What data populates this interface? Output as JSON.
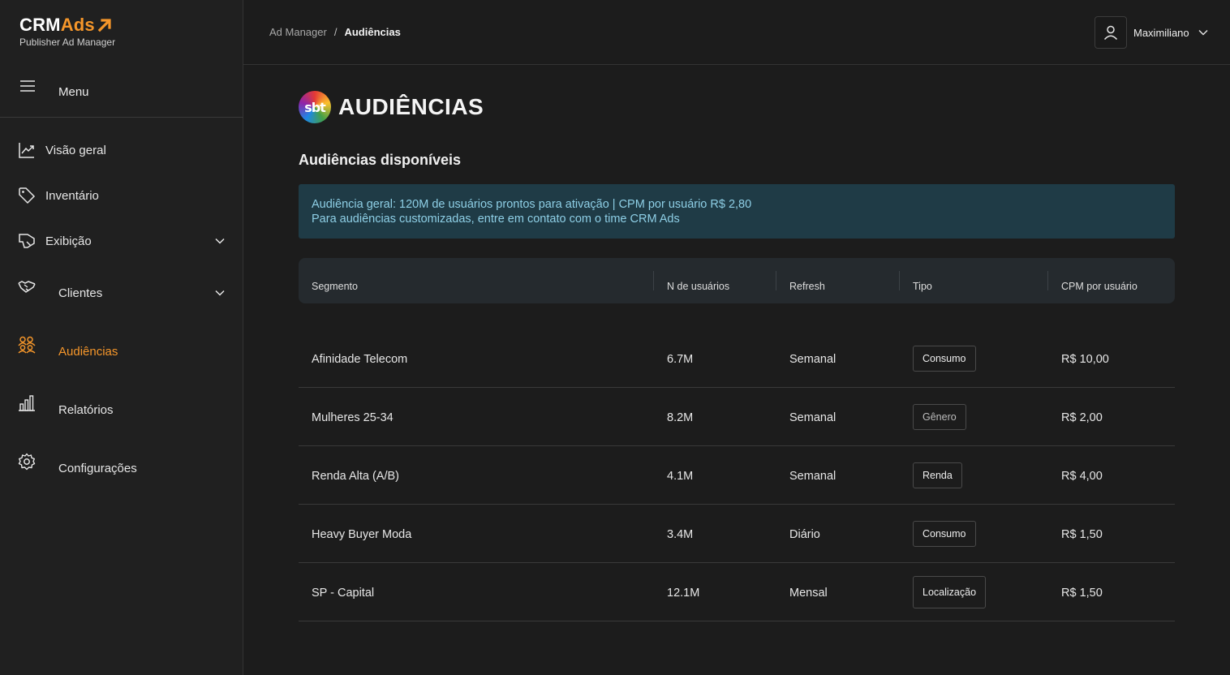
{
  "brand": {
    "name_main": "CRM",
    "name_accent": "Ads",
    "subtitle": "Publisher Ad Manager"
  },
  "sidebar": {
    "menu_label": "Menu",
    "items": [
      {
        "label": "Visão geral",
        "icon": "chart-line-icon"
      },
      {
        "label": "Inventário",
        "icon": "tag-icon"
      },
      {
        "label": "Exibição",
        "icon": "megaphone-icon"
      },
      {
        "label": "Clientes",
        "icon": "handshake-icon"
      },
      {
        "label": "Audiências",
        "icon": "users-group-icon",
        "active": true
      },
      {
        "label": "Relatórios",
        "icon": "bar-chart-icon"
      },
      {
        "label": "Configurações",
        "icon": "gear-icon"
      }
    ]
  },
  "topbar": {
    "breadcrumb": {
      "parent": "Ad Manager",
      "separator": "/",
      "current": "Audiências"
    },
    "user_name": "Maximiliano"
  },
  "page": {
    "logo_text": "sbt",
    "title": "AUDIÊNCIAS",
    "section_title": "Audiências disponíveis",
    "info_line1": "Audiência geral: 120M de usuários prontos para ativação | CPM por usuário R$ 2,80",
    "info_line2": "Para audiências customizadas, entre em contato com o time CRM Ads"
  },
  "table": {
    "headers": [
      "Segmento",
      "N de usuários",
      "Refresh",
      "Tipo",
      "CPM por usuário"
    ],
    "rows": [
      {
        "segment": "Afinidade Telecom",
        "users": "6.7M",
        "refresh": "Semanal",
        "type": "Consumo",
        "cpm": "R$ 10,00"
      },
      {
        "segment": "Mulheres 25-34",
        "users": "8.2M",
        "refresh": "Semanal",
        "type": "Gênero",
        "cpm": "R$ 2,00"
      },
      {
        "segment": "Renda Alta (A/B)",
        "users": "4.1M",
        "refresh": "Semanal",
        "type": "Renda",
        "cpm": "R$ 4,00"
      },
      {
        "segment": "Heavy Buyer Moda",
        "users": "3.4M",
        "refresh": "Diário",
        "type": "Consumo",
        "cpm": "R$ 1,50"
      },
      {
        "segment": "SP - Capital",
        "users": "12.1M",
        "refresh": "Mensal",
        "type": "Localização",
        "cpm": "R$ 1,50"
      }
    ]
  },
  "colors": {
    "accent": "#f5962a",
    "info_bg": "#1f3b46",
    "info_text": "#8ecfe6"
  }
}
